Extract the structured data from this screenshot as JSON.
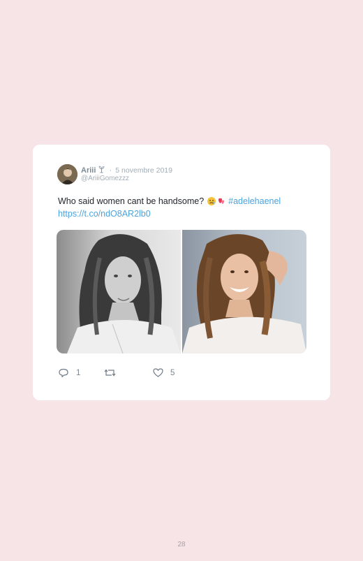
{
  "tweet": {
    "author_name": "Ariii",
    "separator": "·",
    "date": "5 novembre 2019",
    "handle": "@AriiiGomezzz",
    "text": "Who said women cant be handsome?",
    "emojis": "😢💕",
    "hashtag": "#adelehaenel",
    "url": "https://t.co/ndO8AR2lb0",
    "reply_count": "1",
    "retweet_count": "",
    "like_count": "5"
  },
  "icons": {
    "author_badge": "plant-icon",
    "reply": "reply-icon",
    "retweet": "retweet-icon",
    "like": "heart-icon"
  },
  "colors": {
    "page_background": "#f6e4e6",
    "card_background": "#ffffff",
    "link": "#4aa3df",
    "meta_text": "#a3adb6"
  },
  "page": {
    "number": "28"
  }
}
